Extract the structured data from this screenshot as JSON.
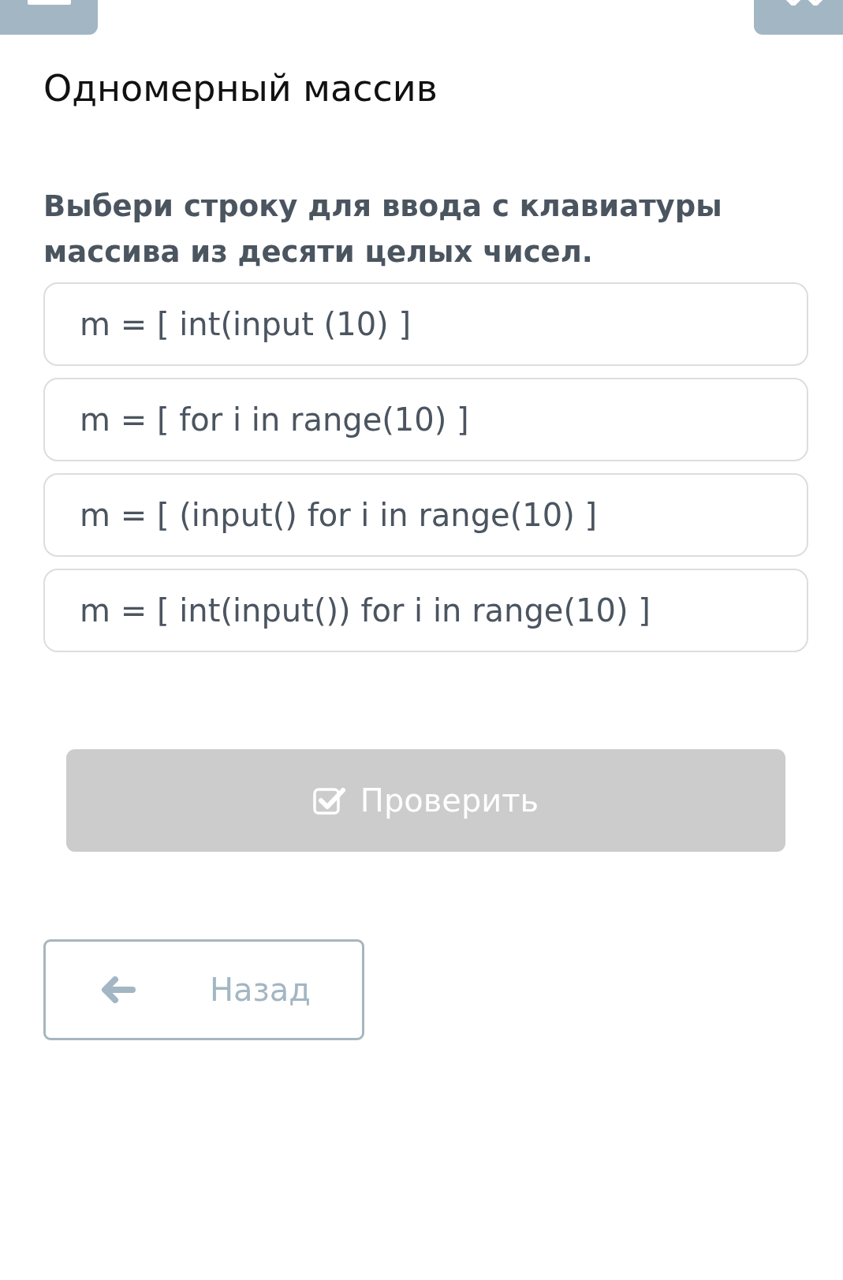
{
  "title": "Одномерный массив",
  "question": "Выбери строку для ввода с клавиатуры массива из десяти целых чисел.",
  "options": [
    {
      "text": "m = [ int(input (10) ]",
      "selected": false
    },
    {
      "text": "m = [ for i in range(10) ]",
      "selected": false
    },
    {
      "text": "m = [ (input() for i in range(10) ]",
      "selected": false
    },
    {
      "text": "m = [ int(input()) for i in range(10) ]",
      "selected": false
    }
  ],
  "check_button": {
    "label": "Проверить",
    "disabled": true
  },
  "back_button": {
    "label": "Назад"
  }
}
